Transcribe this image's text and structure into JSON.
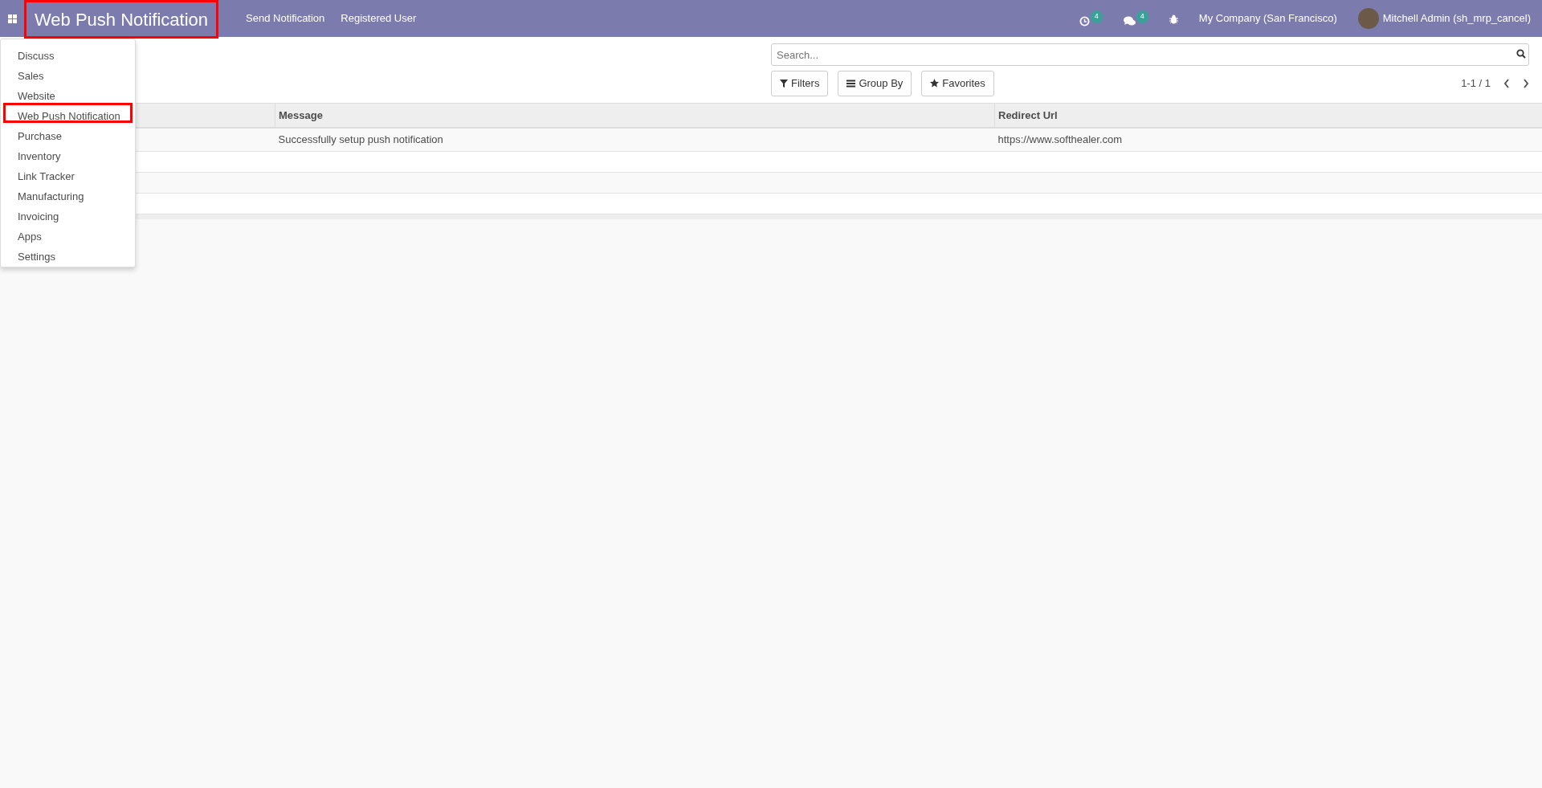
{
  "navbar": {
    "app_title": "Web Push Notification",
    "app_title_highlighted": true,
    "menu": [
      "Send Notification",
      "Registered User"
    ],
    "activity_count": "4",
    "message_count": "4",
    "company": "My Company (San Francisco)",
    "user": "Mitchell Admin (sh_mrp_cancel)"
  },
  "apps_menu": {
    "items": [
      {
        "label": "Discuss",
        "highlighted": false
      },
      {
        "label": "Sales",
        "highlighted": false
      },
      {
        "label": "Website",
        "highlighted": false
      },
      {
        "label": "Web Push Notification",
        "highlighted": true
      },
      {
        "label": "Purchase",
        "highlighted": false
      },
      {
        "label": "Inventory",
        "highlighted": false
      },
      {
        "label": "Link Tracker",
        "highlighted": false
      },
      {
        "label": "Manufacturing",
        "highlighted": false
      },
      {
        "label": "Invoicing",
        "highlighted": false
      },
      {
        "label": "Apps",
        "highlighted": false
      },
      {
        "label": "Settings",
        "highlighted": false
      }
    ]
  },
  "search": {
    "placeholder": "Search..."
  },
  "filters": [
    "Filters",
    "Group By",
    "Favorites"
  ],
  "pager": "1-1 / 1",
  "table": {
    "columns": [
      "",
      "Message",
      "Redirect Url"
    ],
    "rows": [
      [
        "",
        "Successfully setup push notification",
        "https://www.softhealer.com"
      ]
    ]
  }
}
